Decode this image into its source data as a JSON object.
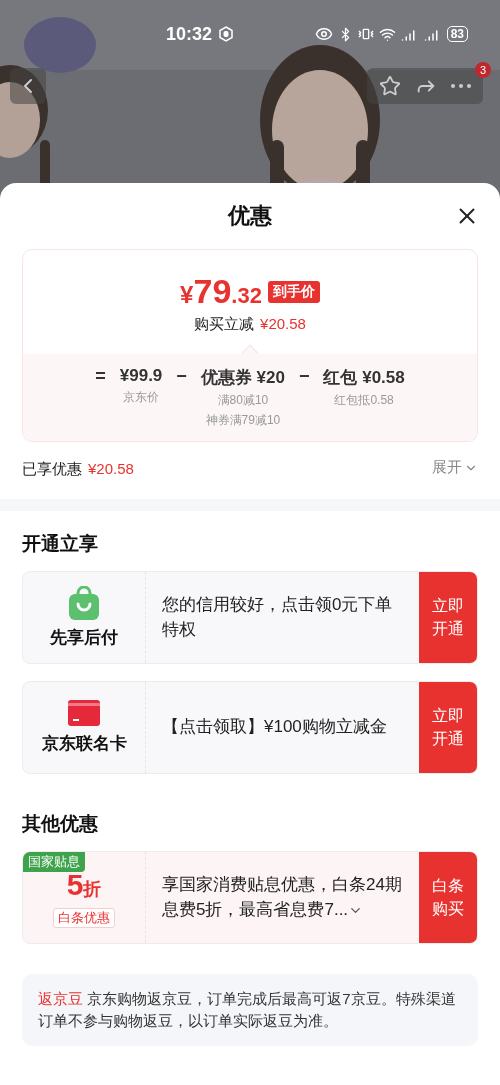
{
  "status_bar": {
    "time": "10:32",
    "battery": "83"
  },
  "nav": {
    "badge": "3"
  },
  "sheet": {
    "title": "优惠",
    "price": {
      "symbol": "¥",
      "integer": "79",
      "decimal": ".32",
      "tag": "到手价",
      "saving_label": "购买立减",
      "saving_value": "¥20.58",
      "breakdown": [
        {
          "operator": "=",
          "value": "¥99.9",
          "notes": [
            "京东价"
          ]
        },
        {
          "operator": "−",
          "value": "优惠券 ¥20",
          "notes": [
            "满80减10",
            "神券满79减10"
          ]
        },
        {
          "operator": "−",
          "value": "红包 ¥0.58",
          "notes": [
            "红包抵0.58"
          ]
        }
      ]
    },
    "enjoyed": {
      "label": "已享优惠",
      "value": "¥20.58",
      "expand": "展开"
    },
    "sections": [
      {
        "title": "开通立享",
        "offers": [
          {
            "kind": "bag",
            "name": "先享后付",
            "text": "您的信用较好，点击领0元下单特权",
            "action": "立即开通",
            "expandable": false
          },
          {
            "kind": "card",
            "name": "京东联名卡",
            "text": "【点击领取】¥100购物立减金",
            "action": "立即开通",
            "expandable": false
          }
        ]
      },
      {
        "title": "其他优惠",
        "offers": [
          {
            "kind": "discount",
            "badge": "国家贴息",
            "big": "5",
            "unit": "折",
            "name": "白条优惠",
            "text": "享国家消费贴息优惠，白条24期息费5折，最高省息费7...",
            "action": "白条购买",
            "expandable": true
          }
        ]
      }
    ],
    "note": {
      "tag": "返京豆",
      "text": "京东购物返京豆，订单完成后最高可返7京豆。特殊渠道订单不参与购物返豆，以订单实际返豆为准。"
    }
  }
}
